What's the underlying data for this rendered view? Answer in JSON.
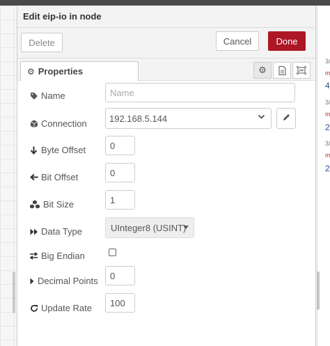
{
  "dialog": {
    "title": "Edit eip-io in node",
    "delete_label": "Delete",
    "cancel_label": "Cancel",
    "done_label": "Done"
  },
  "tabs": {
    "properties_label": "Properties",
    "icons": [
      "gear-icon",
      "file-icon",
      "frame-icon"
    ]
  },
  "form": {
    "name": {
      "label": "Name",
      "value": "",
      "placeholder": "Name",
      "icon": "tag-icon"
    },
    "connection": {
      "label": "Connection",
      "value": "192.168.5.144",
      "icon": "cube-icon"
    },
    "byte_offset": {
      "label": "Byte Offset",
      "value": "0",
      "icon": "arrow-down-icon"
    },
    "bit_offset": {
      "label": "Bit Offset",
      "value": "0",
      "icon": "arrow-left-icon"
    },
    "bit_size": {
      "label": "Bit Size",
      "value": "1",
      "icon": "cubes-icon"
    },
    "data_type": {
      "label": "Data Type",
      "value": "UInteger8 (USINT)",
      "icon": "forward-icon"
    },
    "big_endian": {
      "label": "Big Endian",
      "checked": false,
      "icon": "exchange-icon"
    },
    "decimal_points": {
      "label": "Decimal Points",
      "value": "0",
      "icon": "caret-right-icon"
    },
    "update_rate": {
      "label": "Update Rate",
      "value": "100",
      "icon": "refresh-icon"
    }
  },
  "sidebar": {
    "entries": [
      {
        "ts": "3/",
        "topic": "m",
        "value": "4"
      },
      {
        "ts": "3/",
        "topic": "m",
        "value": "2"
      },
      {
        "ts": "3/",
        "topic": "m",
        "value": "2"
      }
    ]
  },
  "colors": {
    "done_button": "#ad1625",
    "topic_text": "#a6333f",
    "value_text": "#2c4f8a"
  }
}
